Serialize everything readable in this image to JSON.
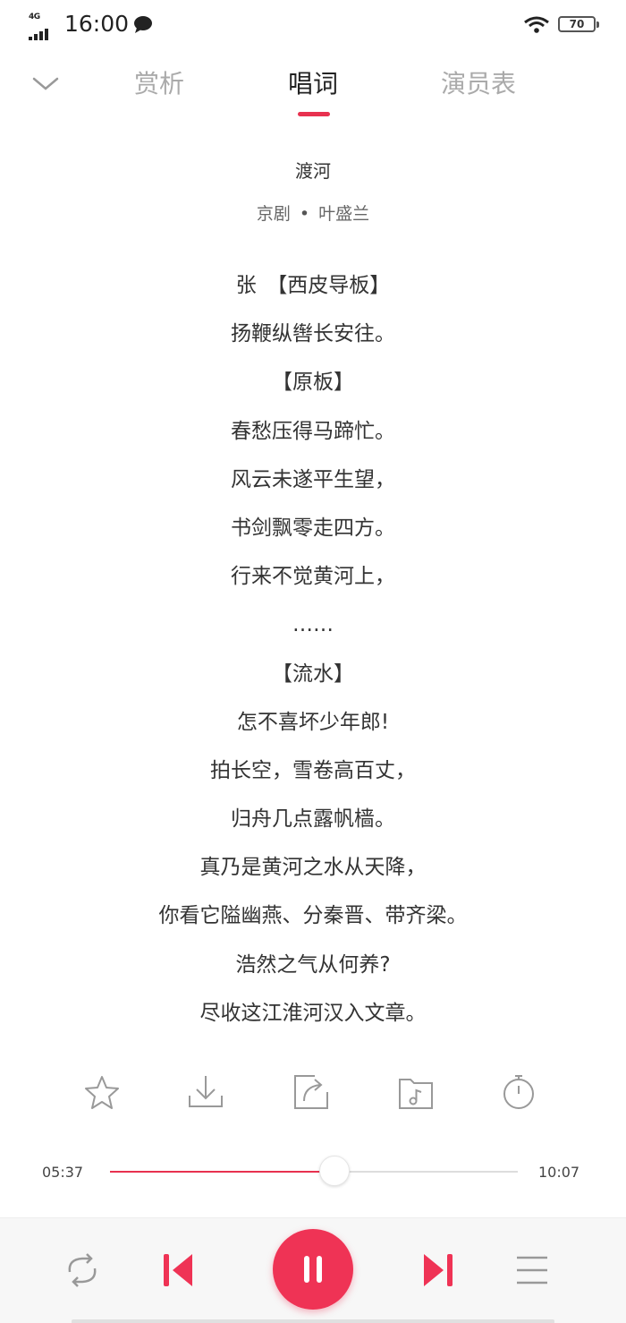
{
  "status_bar": {
    "network": "4G",
    "time": "16:00",
    "battery": "70"
  },
  "tabs": [
    {
      "label": "赏析",
      "active": false
    },
    {
      "label": "唱词",
      "active": true
    },
    {
      "label": "演员表",
      "active": false
    }
  ],
  "song": {
    "title": "渡河",
    "genre": "京剧",
    "separator": "•",
    "performer": "叶盛兰"
  },
  "lyrics": [
    "张　【西皮导板】",
    "扬鞭纵辔长安往。",
    "【原板】",
    "春愁压得马蹄忙。",
    "风云未遂平生望，",
    "书剑飘零走四方。",
    "行来不觉黄河上，",
    "……",
    "【流水】",
    "怎不喜坏少年郎!",
    "拍长空，雪卷高百丈，",
    "归舟几点露帆樯。",
    "真乃是黄河之水从天降，",
    "你看它隘幽燕、分秦晋、带齐梁。",
    "浩然之气从何养?",
    "尽收这江淮河汉入文章。"
  ],
  "actions": [
    "star-icon",
    "download-icon",
    "share-icon",
    "add-to-playlist-icon",
    "timer-icon"
  ],
  "player": {
    "current_time": "05:37",
    "total_time": "10:07",
    "progress_fraction": 0.55,
    "state": "playing",
    "accent_color": "#ef3355"
  }
}
